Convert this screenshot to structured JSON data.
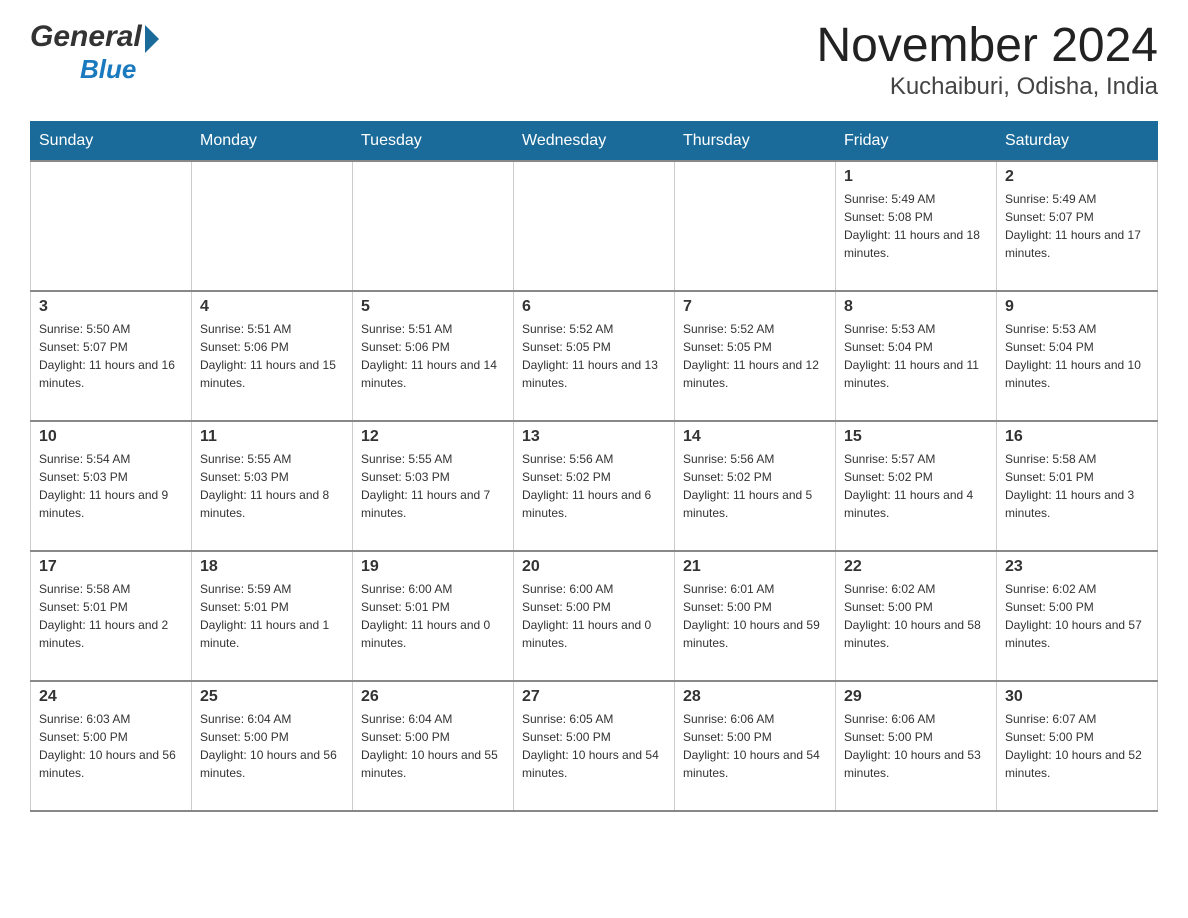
{
  "header": {
    "title": "November 2024",
    "subtitle": "Kuchaiburi, Odisha, India"
  },
  "logo": {
    "general": "General",
    "blue": "Blue"
  },
  "days": [
    "Sunday",
    "Monday",
    "Tuesday",
    "Wednesday",
    "Thursday",
    "Friday",
    "Saturday"
  ],
  "weeks": [
    [
      {
        "num": "",
        "sunrise": "",
        "sunset": "",
        "daylight": ""
      },
      {
        "num": "",
        "sunrise": "",
        "sunset": "",
        "daylight": ""
      },
      {
        "num": "",
        "sunrise": "",
        "sunset": "",
        "daylight": ""
      },
      {
        "num": "",
        "sunrise": "",
        "sunset": "",
        "daylight": ""
      },
      {
        "num": "",
        "sunrise": "",
        "sunset": "",
        "daylight": ""
      },
      {
        "num": "1",
        "sunrise": "Sunrise: 5:49 AM",
        "sunset": "Sunset: 5:08 PM",
        "daylight": "Daylight: 11 hours and 18 minutes."
      },
      {
        "num": "2",
        "sunrise": "Sunrise: 5:49 AM",
        "sunset": "Sunset: 5:07 PM",
        "daylight": "Daylight: 11 hours and 17 minutes."
      }
    ],
    [
      {
        "num": "3",
        "sunrise": "Sunrise: 5:50 AM",
        "sunset": "Sunset: 5:07 PM",
        "daylight": "Daylight: 11 hours and 16 minutes."
      },
      {
        "num": "4",
        "sunrise": "Sunrise: 5:51 AM",
        "sunset": "Sunset: 5:06 PM",
        "daylight": "Daylight: 11 hours and 15 minutes."
      },
      {
        "num": "5",
        "sunrise": "Sunrise: 5:51 AM",
        "sunset": "Sunset: 5:06 PM",
        "daylight": "Daylight: 11 hours and 14 minutes."
      },
      {
        "num": "6",
        "sunrise": "Sunrise: 5:52 AM",
        "sunset": "Sunset: 5:05 PM",
        "daylight": "Daylight: 11 hours and 13 minutes."
      },
      {
        "num": "7",
        "sunrise": "Sunrise: 5:52 AM",
        "sunset": "Sunset: 5:05 PM",
        "daylight": "Daylight: 11 hours and 12 minutes."
      },
      {
        "num": "8",
        "sunrise": "Sunrise: 5:53 AM",
        "sunset": "Sunset: 5:04 PM",
        "daylight": "Daylight: 11 hours and 11 minutes."
      },
      {
        "num": "9",
        "sunrise": "Sunrise: 5:53 AM",
        "sunset": "Sunset: 5:04 PM",
        "daylight": "Daylight: 11 hours and 10 minutes."
      }
    ],
    [
      {
        "num": "10",
        "sunrise": "Sunrise: 5:54 AM",
        "sunset": "Sunset: 5:03 PM",
        "daylight": "Daylight: 11 hours and 9 minutes."
      },
      {
        "num": "11",
        "sunrise": "Sunrise: 5:55 AM",
        "sunset": "Sunset: 5:03 PM",
        "daylight": "Daylight: 11 hours and 8 minutes."
      },
      {
        "num": "12",
        "sunrise": "Sunrise: 5:55 AM",
        "sunset": "Sunset: 5:03 PM",
        "daylight": "Daylight: 11 hours and 7 minutes."
      },
      {
        "num": "13",
        "sunrise": "Sunrise: 5:56 AM",
        "sunset": "Sunset: 5:02 PM",
        "daylight": "Daylight: 11 hours and 6 minutes."
      },
      {
        "num": "14",
        "sunrise": "Sunrise: 5:56 AM",
        "sunset": "Sunset: 5:02 PM",
        "daylight": "Daylight: 11 hours and 5 minutes."
      },
      {
        "num": "15",
        "sunrise": "Sunrise: 5:57 AM",
        "sunset": "Sunset: 5:02 PM",
        "daylight": "Daylight: 11 hours and 4 minutes."
      },
      {
        "num": "16",
        "sunrise": "Sunrise: 5:58 AM",
        "sunset": "Sunset: 5:01 PM",
        "daylight": "Daylight: 11 hours and 3 minutes."
      }
    ],
    [
      {
        "num": "17",
        "sunrise": "Sunrise: 5:58 AM",
        "sunset": "Sunset: 5:01 PM",
        "daylight": "Daylight: 11 hours and 2 minutes."
      },
      {
        "num": "18",
        "sunrise": "Sunrise: 5:59 AM",
        "sunset": "Sunset: 5:01 PM",
        "daylight": "Daylight: 11 hours and 1 minute."
      },
      {
        "num": "19",
        "sunrise": "Sunrise: 6:00 AM",
        "sunset": "Sunset: 5:01 PM",
        "daylight": "Daylight: 11 hours and 0 minutes."
      },
      {
        "num": "20",
        "sunrise": "Sunrise: 6:00 AM",
        "sunset": "Sunset: 5:00 PM",
        "daylight": "Daylight: 11 hours and 0 minutes."
      },
      {
        "num": "21",
        "sunrise": "Sunrise: 6:01 AM",
        "sunset": "Sunset: 5:00 PM",
        "daylight": "Daylight: 10 hours and 59 minutes."
      },
      {
        "num": "22",
        "sunrise": "Sunrise: 6:02 AM",
        "sunset": "Sunset: 5:00 PM",
        "daylight": "Daylight: 10 hours and 58 minutes."
      },
      {
        "num": "23",
        "sunrise": "Sunrise: 6:02 AM",
        "sunset": "Sunset: 5:00 PM",
        "daylight": "Daylight: 10 hours and 57 minutes."
      }
    ],
    [
      {
        "num": "24",
        "sunrise": "Sunrise: 6:03 AM",
        "sunset": "Sunset: 5:00 PM",
        "daylight": "Daylight: 10 hours and 56 minutes."
      },
      {
        "num": "25",
        "sunrise": "Sunrise: 6:04 AM",
        "sunset": "Sunset: 5:00 PM",
        "daylight": "Daylight: 10 hours and 56 minutes."
      },
      {
        "num": "26",
        "sunrise": "Sunrise: 6:04 AM",
        "sunset": "Sunset: 5:00 PM",
        "daylight": "Daylight: 10 hours and 55 minutes."
      },
      {
        "num": "27",
        "sunrise": "Sunrise: 6:05 AM",
        "sunset": "Sunset: 5:00 PM",
        "daylight": "Daylight: 10 hours and 54 minutes."
      },
      {
        "num": "28",
        "sunrise": "Sunrise: 6:06 AM",
        "sunset": "Sunset: 5:00 PM",
        "daylight": "Daylight: 10 hours and 54 minutes."
      },
      {
        "num": "29",
        "sunrise": "Sunrise: 6:06 AM",
        "sunset": "Sunset: 5:00 PM",
        "daylight": "Daylight: 10 hours and 53 minutes."
      },
      {
        "num": "30",
        "sunrise": "Sunrise: 6:07 AM",
        "sunset": "Sunset: 5:00 PM",
        "daylight": "Daylight: 10 hours and 52 minutes."
      }
    ]
  ]
}
